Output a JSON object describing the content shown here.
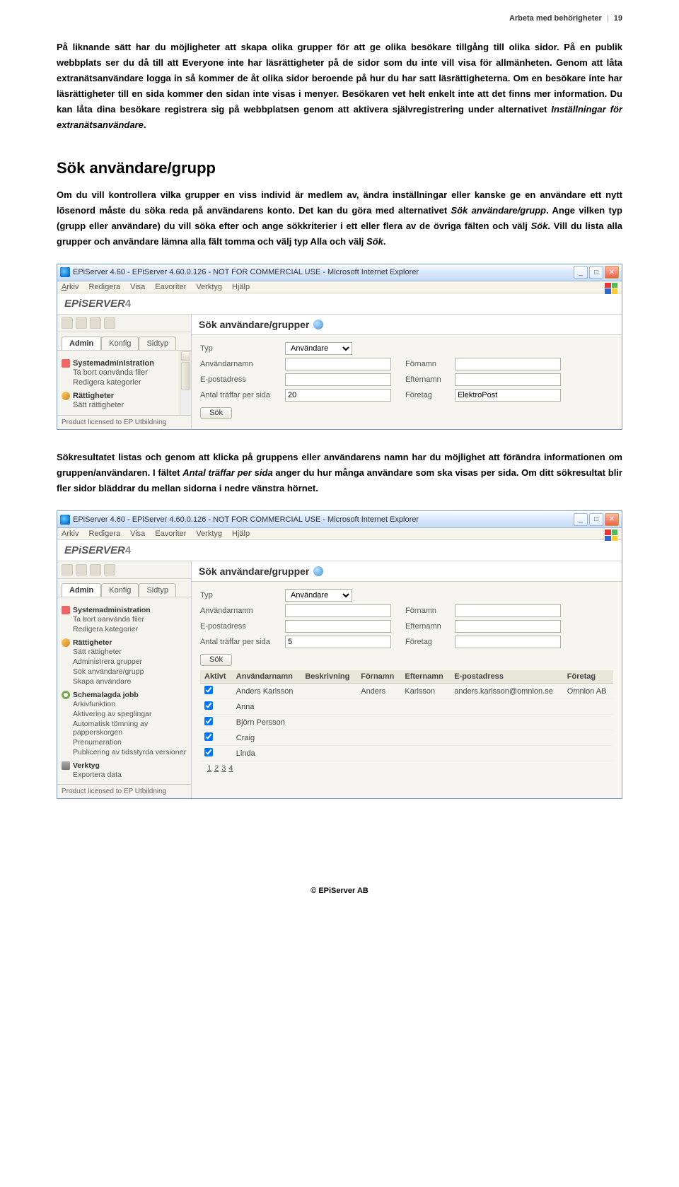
{
  "header": {
    "chapter": "Arbeta med behörigheter",
    "page": "19"
  },
  "para1": "På liknande sätt har du möjligheter att skapa olika grupper för att ge olika besökare tillgång till olika sidor. På en publik webbplats ser du då till att Everyone inte har läsrättigheter på de sidor som du inte vill visa för allmänheten. Genom att låta extranätsanvändare logga in så kommer de åt olika sidor beroende på hur du har satt läsrättigheterna. Om en besökare inte har läsrättigheter till en sida kommer den sidan inte visas i menyer. Besökaren vet helt enkelt inte att det finns mer information. Du kan låta dina besökare registrera sig på webbplatsen genom att aktivera självregistrering under alternativet ",
  "para1_ital": "Inställningar för extranätsanvändare",
  "para1_end": ".",
  "section_title": "Sök användare/grupp",
  "para2a": "Om du vill kontrollera vilka grupper en viss individ är medlem av, ändra inställningar eller kanske ge en användare ett nytt lösenord måste du söka reda på användarens konto. Det kan du göra med alternativet ",
  "para2a_ital": "Sök användare/grupp",
  "para2b": ". Ange vilken typ (grupp eller användare) du vill söka efter och ange sökkriterier i ett eller flera av de övriga fälten och välj ",
  "para2b_ital": "Sök",
  "para2c": ". Vill du lista alla grupper och användare lämna alla fält tomma och välj typ Alla och välj ",
  "para2c_ital": "Sök",
  "para2d": ".",
  "para3a": "Sökresultatet listas och genom att klicka på gruppens eller användarens namn har du möjlighet att förändra informationen om gruppen/användaren. I fältet ",
  "para3a_ital": "Antal träffar per sida",
  "para3b": " anger du hur många användare som ska visas per sida. Om ditt sökresultat blir fler sidor bläddrar du mellan sidorna i nedre vänstra hörnet.",
  "footer": "© EPiServer AB",
  "win": {
    "title": "EPiServer 4.60 - EPiServer 4.60.0.126 - NOT FOR COMMERCIAL USE - Microsoft Internet Explorer",
    "menu": {
      "file": "Arkiv",
      "edit": "Redigera",
      "view": "Visa",
      "fav": "Eavoriter",
      "tools": "Verktyg",
      "help": "Hjälp"
    },
    "logo": "EPiSERVER",
    "logo4": "4",
    "tabs": {
      "admin": "Admin",
      "konfig": "Konfig",
      "sidtyp": "Sidtyp"
    },
    "side_sysadmin": "Systemadministration",
    "side_sys_items": [
      "Ta bort oanvända filer",
      "Redigera kategorier"
    ],
    "side_ratt": "Rättigheter",
    "side_ratt_items_short": [
      "Sätt rättigheter"
    ],
    "side_ratt_items_long": [
      "Sätt rättigheter",
      "Administrera grupper",
      "Sök användare/grupp",
      "Skapa användare"
    ],
    "side_schema": "Schemalagda jobb",
    "side_schema_items": [
      "Arkivfunktion",
      "Aktivering av speglingar",
      "Automatisk tömning av papperskorgen",
      "Prenumeration",
      "Publicering av tidsstyrda versioner"
    ],
    "side_verktyg": "Verktyg",
    "side_verktyg_items": [
      "Exportera data"
    ],
    "licensed": "Product licensed to EP Utbildning",
    "panel_title": "Sök användare/grupper",
    "labels": {
      "typ": "Typ",
      "anv": "Användarnamn",
      "epost": "E-postadress",
      "antal": "Antal träffar per sida",
      "fn": "Förnamn",
      "en": "Efternamn",
      "ftg": "Företag"
    },
    "typ_val": "Användare",
    "sok": "Sök"
  },
  "shot1": {
    "antal_val": "20",
    "ftg_val": "ElektroPost"
  },
  "shot2": {
    "antal_val": "5",
    "cols": [
      "Aktivt",
      "Användarnamn",
      "Beskrivning",
      "Förnamn",
      "Efternamn",
      "E-postadress",
      "Företag"
    ],
    "rows": [
      {
        "u": "Anders Karlsson",
        "d": "",
        "f": "Anders",
        "e": "Karlsson",
        "m": "anders.karlsson@omnion.se",
        "c": "Omnion AB"
      },
      {
        "u": "Anna",
        "d": "",
        "f": "",
        "e": "",
        "m": "",
        "c": ""
      },
      {
        "u": "Björn Persson",
        "d": "",
        "f": "",
        "e": "",
        "m": "",
        "c": ""
      },
      {
        "u": "Craig",
        "d": "",
        "f": "",
        "e": "",
        "m": "",
        "c": ""
      },
      {
        "u": "Linda",
        "d": "",
        "f": "",
        "e": "",
        "m": "",
        "c": ""
      }
    ],
    "pager": [
      "1",
      "2",
      "3",
      "4"
    ]
  }
}
